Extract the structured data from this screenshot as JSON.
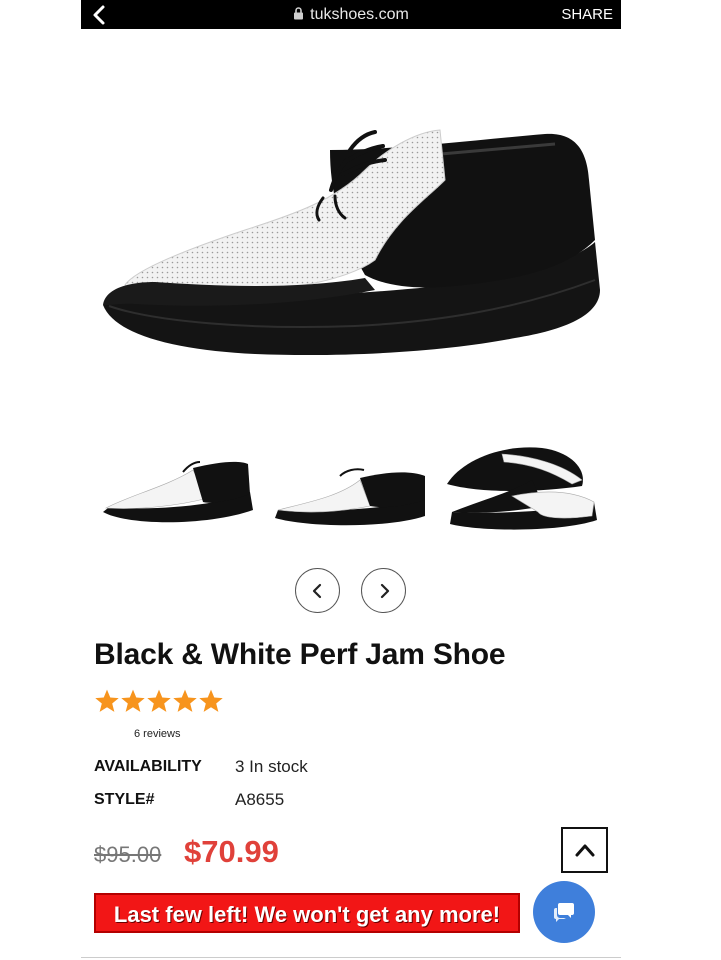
{
  "browser": {
    "back_icon": "chevron-left-icon",
    "url": "tukshoes.com",
    "share_label": "SHARE"
  },
  "product": {
    "title": "Black & White Perf Jam Shoe",
    "rating": 5,
    "rating_max": 5,
    "reviews": "6 reviews",
    "availability_label": "AVAILABILITY",
    "availability_value": "3 In stock",
    "style_label": "STYLE#",
    "style_value": "A8655",
    "old_price": "$95.00",
    "new_price": "$70.99"
  },
  "gallery": {
    "thumbnail_count": 3,
    "prev_icon": "chevron-left-icon",
    "next_icon": "chevron-right-icon"
  },
  "promo": {
    "banner_text": "Last few left! We won't get any more!"
  },
  "colors": {
    "price_red": "#e0413a",
    "banner_red": "#f21616",
    "star_orange": "#f7941d",
    "chat_blue": "#3f7fdb"
  }
}
